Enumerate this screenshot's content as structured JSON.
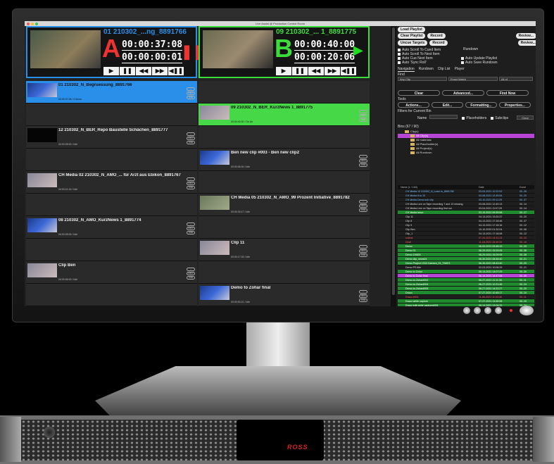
{
  "window": {
    "title": "Live Assist @ Production Control Room"
  },
  "players": [
    {
      "id": "01 210302_...ng_8891766",
      "letter": "A",
      "tc1": "00:00:37:08",
      "tc2": "00:00:00:01",
      "state_icon": "pause-icon"
    },
    {
      "id": "09 210302_... 1_8891775",
      "letter": "B",
      "tc1": "00:00:40:00",
      "tc2": "00:00:20:06",
      "state_icon": "play-icon"
    }
  ],
  "transport": [
    "▶",
    "❚❚",
    "◀◀",
    "▶▶",
    "◀❚❚"
  ],
  "clip_icons": [
    "→",
    "INFO",
    "CUE"
  ],
  "left_clips": [
    {
      "title": "01 210302_N_Begruessung_8891766",
      "meta": "00:00:37:08 / 2 Items",
      "selected": "blue"
    },
    {
      "title": "",
      "meta": ""
    },
    {
      "title": "12 210302_N_BER_Repo Baustelle Schächen_8891777",
      "meta": "00:00:28:00 / Idle"
    },
    {
      "title": "",
      "meta": ""
    },
    {
      "title": "CH Media 02 210302_N_AMO_... für Arzt aus Ebikon_8891767",
      "meta": "00:00:21:16 / Idle"
    },
    {
      "title": "",
      "meta": ""
    },
    {
      "title": "08 210302_N_AMO_KurzNews 1_8891774",
      "meta": "00:00:28:09 / Idle"
    },
    {
      "title": "",
      "meta": ""
    },
    {
      "title": "Clip Ben",
      "meta": "00:00:06:00 / Idle"
    },
    {
      "title": "",
      "meta": ""
    }
  ],
  "right_clips": [
    {
      "title": "",
      "meta": ""
    },
    {
      "title": "09 210302_N_BER_KurzNews 1_8891775",
      "meta": "00:00:40:00 / On Air",
      "selected": "green"
    },
    {
      "title": "",
      "meta": ""
    },
    {
      "title": "Ben new clip #003 - Ben new clip2",
      "meta": "00:00:06:00 / Idle"
    },
    {
      "title": "",
      "meta": ""
    },
    {
      "title": "CH Media 05 210302_N_AMO_99 Prozent Initiative_8891782",
      "meta": "00:00:33:17 / Idle"
    },
    {
      "title": "",
      "meta": ""
    },
    {
      "title": "Clip 11",
      "meta": "00:00:17:03 / Idle"
    },
    {
      "title": "",
      "meta": ""
    },
    {
      "title": "Demo to Zohar final",
      "meta": "00:00:53:21 / Idle"
    }
  ],
  "right": {
    "load_playlist": "Load Playlist",
    "clear_playlist": "Clear Playlist",
    "record": "Record",
    "review": "Review...",
    "uncue_targets": "Uncue Targets",
    "options": [
      "Auto Scroll To Cued Item",
      "Auto Scroll To Next Item",
      "Auto Cue Next Item",
      "Auto 'Sync Roll'"
    ],
    "options_right": [
      "Auto Update Playlist",
      "Auto Save Rundown"
    ],
    "rundown_label": "Rundown",
    "tabs": [
      "Navigation",
      "Rundown",
      "Clip List",
      "Player"
    ],
    "find_label": "Find",
    "find_selects": [
      "Any Clip",
      "Exact Match",
      "All of"
    ],
    "buttons1": [
      "Clear",
      "Advanced...",
      "Find Now"
    ],
    "tools_label": "Tools",
    "buttons2": [
      "Actions...",
      "Edit...",
      "Formatting...",
      "Properties..."
    ],
    "filters_label": "Filters for Current Bin",
    "name_label": "Name",
    "placeholders": "Placeholders",
    "subclips": "Subclips",
    "clear_small": "Clear",
    "bins_label": "Bins (67 / 90)",
    "bins": [
      "Clip(s)",
      "All Clip(s)",
      "All materials",
      "All Placeholder(s)",
      "All Project(s)",
      "All Rundown"
    ],
    "table_headers": [
      "Name (1 / 163)",
      "Date",
      "Durat"
    ],
    "files": [
      {
        "name": "CH Media 10 210302_N_Lead-In_8891780",
        "date": "03-04-2021 12:22:02",
        "dur": "00..26",
        "c": "#7ec0ff"
      },
      {
        "name": "CH Media 8 to 10",
        "date": "03-08-2021 12:45:54",
        "dur": "00..20",
        "c": "#7ec0ff"
      },
      {
        "name": "CH Media Demo sub clip",
        "date": "03-10-2021 09:11:29",
        "dur": "00..37",
        "c": "#7ec0ff"
      },
      {
        "name": "CH Media Live on Tape recording 7 and 13 missing",
        "date": "03-08-2021 12:40:13",
        "dur": "00..14",
        "c": "#ddd"
      },
      {
        "name": "CH Media Live on Tape recording first run",
        "date": "03-04-2021 11:07:29",
        "dur": "00..14",
        "c": "#ddd"
      },
      {
        "name": "CH Media rerun",
        "date": "03-10-2021 09:39:58",
        "dur": "00..17",
        "c": "#fff",
        "bg": "#1f8a2e"
      },
      {
        "name": "Clip 11",
        "date": "04-13-2021 13:20:37",
        "dur": "00..20",
        "c": "#ddd"
      },
      {
        "name": "Clip 8",
        "date": "04-13-2021 17:18:46",
        "dur": "00..47",
        "c": "#ddd"
      },
      {
        "name": "Clip 9",
        "date": "04-13-2021 17:18:16",
        "dur": "00..12",
        "c": "#ddd"
      },
      {
        "name": "Clip Ben",
        "date": "10-10-2020 01:32:04",
        "dur": "00..06",
        "c": "#ddd"
      },
      {
        "name": "Clip_1",
        "date": "04-13-2021 17:18:08",
        "dur": "00..12",
        "c": "#ddd"
      },
      {
        "name": "coleos",
        "date": "07-20-2021 14:31:24",
        "dur": "00..20",
        "c": "#ff6060"
      },
      {
        "name": "Devil",
        "date": "11-18-2021 15:40:33",
        "dur": "00..15",
        "c": "#ff6060"
      },
      {
        "name": "Demo",
        "date": "06-00-2021 09:48:19",
        "dur": "00..25",
        "c": "#fff",
        "bg": "#1f8a2e"
      },
      {
        "name": "Demo 01",
        "date": "06-29-2021 15:29:05",
        "dur": "00..38",
        "c": "#fff",
        "bg": "#1f8a2e"
      },
      {
        "name": "Demo 2/4600",
        "date": "06-29-2021 15:29:05",
        "dur": "00..38",
        "c": "#fff",
        "bg": "#1f8a2e"
      },
      {
        "name": "Demo clip_news04",
        "date": "06-30-2021 08:48:40",
        "dur": "00..21",
        "c": "#fff",
        "bg": "#1f8a2e"
      },
      {
        "name": "Demo Project 1334 Camera_01_TAKE1",
        "date": "06-30-2021 08:43:40",
        "dur": "00..20",
        "c": "#fff",
        "bg": "#1f8a2e"
      },
      {
        "name": "Demo PS title",
        "date": "02-03-2021 10:06:29",
        "dur": "00..21",
        "c": "#ddd"
      },
      {
        "name": "Demo to Zohar",
        "date": "06-14-2021 14:07:29",
        "dur": "00..30",
        "c": "#fff",
        "bg": "#1f8a2e"
      },
      {
        "name": "Demo to Zohar final",
        "date": "06-14-2021 14:47:08",
        "dur": "00..35",
        "c": "#fff",
        "bg": "#b845d6"
      },
      {
        "name": "Demo-to-Zohar#002",
        "date": "06-27-2021 11:11:36",
        "dur": "00..11",
        "c": "#fff",
        "bg": "#1f8a2e"
      },
      {
        "name": "Demo-to-Zohar#004",
        "date": "06-27-2021 12:21:46",
        "dur": "00..24",
        "c": "#fff",
        "bg": "#1f8a2e"
      },
      {
        "name": "Demo-to-Zohar#005",
        "date": "06-27-2021 14:22:27",
        "dur": "00..20",
        "c": "#fff",
        "bg": "#1f8a2e"
      },
      {
        "name": "Draco",
        "date": "07-27-2021 10:45:17",
        "dur": "00..10",
        "c": "#fff",
        "bg": "#1f8a2e"
      },
      {
        "name": "Draco #001",
        "date": "11-06-2021 11:03:46",
        "dur": "00..11",
        "c": "#ff6060"
      },
      {
        "name": "Draco white capture",
        "date": "07-27-2021 13:30:06",
        "dur": "00..10",
        "c": "#fff",
        "bg": "#1f8a2e"
      },
      {
        "name": "Draco edit white capture#001",
        "date": "06-14-2021 13:04:33",
        "dur": "00..24",
        "c": "#fff",
        "bg": "#1f8a2e"
      }
    ]
  },
  "brand": "ROSS"
}
